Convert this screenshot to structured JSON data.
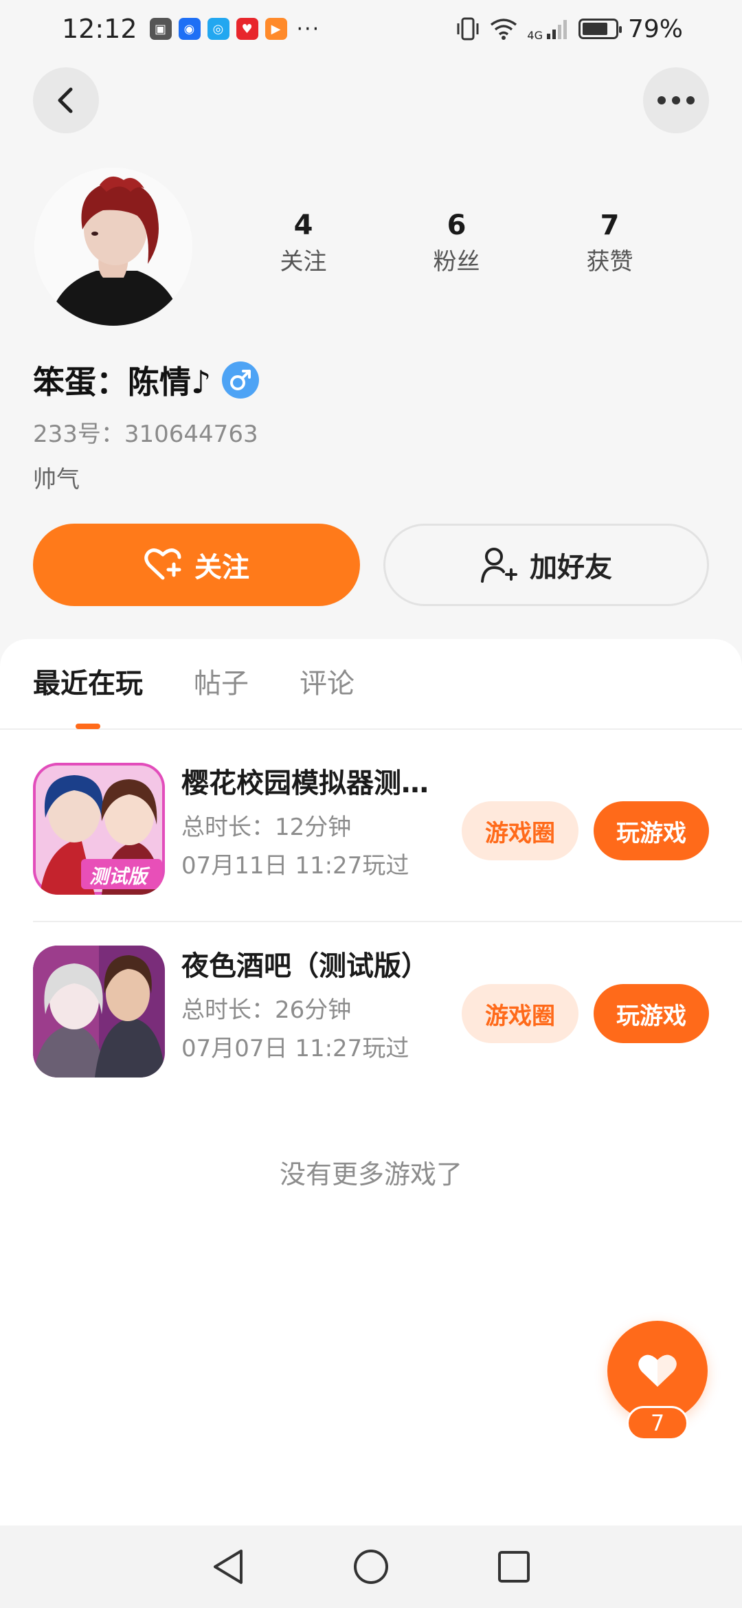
{
  "status_bar": {
    "time": "12:12",
    "battery_percent": "79%",
    "battery_level": 0.79,
    "network": "4G",
    "more": "···"
  },
  "profile": {
    "stats": [
      {
        "value": "4",
        "label": "关注"
      },
      {
        "value": "6",
        "label": "粉丝"
      },
      {
        "value": "7",
        "label": "获赞"
      }
    ],
    "name": "笨蛋：陈情♪",
    "gender_icon": "male-icon",
    "uid": "233号：310644763",
    "bio": "帅气",
    "follow_label": "关注",
    "add_friend_label": "加好友"
  },
  "tabs": [
    {
      "label": "最近在玩",
      "active": true
    },
    {
      "label": "帖子",
      "active": false
    },
    {
      "label": "评论",
      "active": false
    }
  ],
  "games": [
    {
      "title": "樱花校园模拟器测…",
      "duration": "总时长：12分钟",
      "played": "07月11日 11:27玩过",
      "circle_label": "游戏圈",
      "play_label": "玩游戏"
    },
    {
      "title": "夜色酒吧（测试版）",
      "duration": "总时长：26分钟",
      "played": "07月07日 11:27玩过",
      "circle_label": "游戏圈",
      "play_label": "玩游戏"
    }
  ],
  "no_more_text": "没有更多游戏了",
  "like_fab": {
    "count": "7"
  },
  "game1_badge": "测试版",
  "colors": {
    "accent": "#ff6a1a",
    "accent_light": "#ffe9dc",
    "gender_blue": "#4da3f5"
  }
}
